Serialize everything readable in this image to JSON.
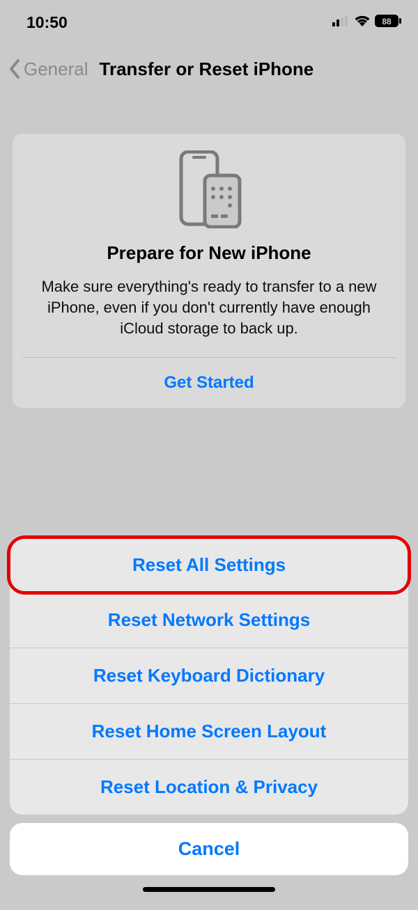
{
  "status": {
    "time": "10:50",
    "battery": "88"
  },
  "nav": {
    "back_label": "General",
    "title": "Transfer or Reset iPhone"
  },
  "card": {
    "title": "Prepare for New iPhone",
    "desc": "Make sure everything's ready to transfer to a new iPhone, even if you don't currently have enough iCloud storage to back up.",
    "action": "Get Started"
  },
  "sheet": {
    "options": [
      "Reset All Settings",
      "Reset Network Settings",
      "Reset Keyboard Dictionary",
      "Reset Home Screen Layout",
      "Reset Location & Privacy"
    ],
    "cancel": "Cancel"
  }
}
